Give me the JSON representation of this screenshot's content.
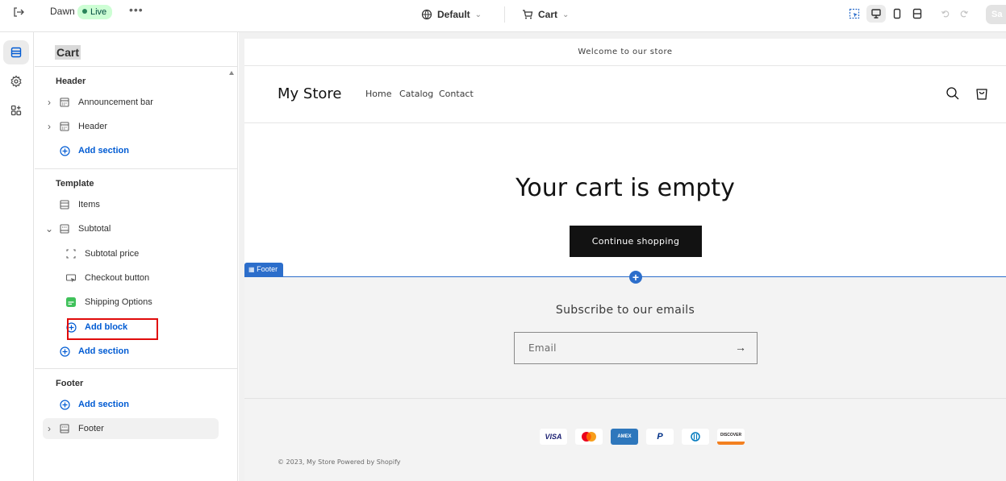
{
  "topbar": {
    "theme_name": "Dawn",
    "live_label": "Live",
    "more_label": "•••",
    "template_selector": "Default",
    "page_selector": "Cart",
    "save_label": "Sa"
  },
  "rail": {
    "items": [
      {
        "name": "sections-icon"
      },
      {
        "name": "theme-settings-icon"
      },
      {
        "name": "app-embeds-icon"
      }
    ]
  },
  "sidebar": {
    "title": "Cart",
    "header_group": {
      "title": "Header",
      "items": [
        "Announcement bar",
        "Header"
      ],
      "add_section": "Add section"
    },
    "template_group": {
      "title": "Template",
      "items_label": "Items",
      "subtotal_label": "Subtotal",
      "blocks": [
        "Subtotal price",
        "Checkout button",
        "Shipping Options"
      ],
      "add_block": "Add block",
      "add_section": "Add section"
    },
    "footer_group": {
      "title": "Footer",
      "add_section": "Add section",
      "footer_label": "Footer"
    }
  },
  "preview": {
    "announcement": "Welcome to our store",
    "store_name": "My Store",
    "nav": [
      "Home",
      "Catalog",
      "Contact"
    ],
    "cart_empty_title": "Your cart is empty",
    "continue_button": "Continue shopping",
    "footer_tag": "Footer",
    "subscribe_heading": "Subscribe to our emails",
    "email_placeholder": "Email",
    "payment_methods": [
      "VISA",
      "Mastercard",
      "AMEX",
      "PayPal",
      "Diners",
      "DISCOVER"
    ],
    "copyright": "© 2023, My Store Powered by Shopify"
  },
  "colors": {
    "accent_blue": "#005bd3",
    "selection_blue": "#2c6ecb",
    "live_green": "#29845a",
    "highlight_red": "#e00b0b"
  }
}
